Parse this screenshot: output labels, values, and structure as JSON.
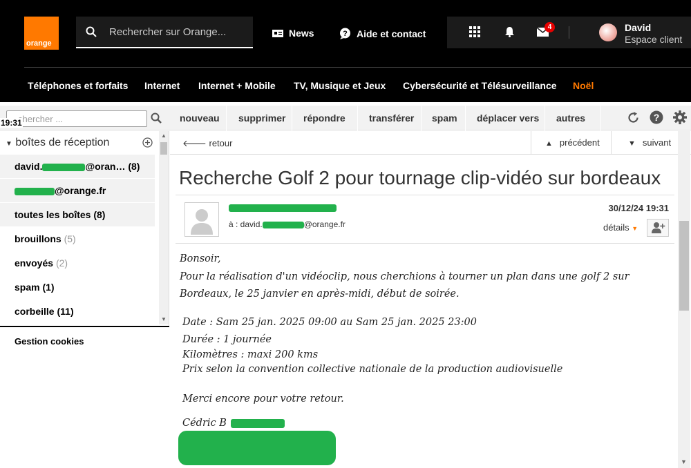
{
  "header": {
    "logo_text": "orange",
    "search_placeholder": "Rechercher sur Orange...",
    "news_label": "News",
    "help_label": "Aide et contact",
    "mail_badge": "4",
    "user_name": "David",
    "user_sub": "Espace client"
  },
  "nav": {
    "items": [
      "Téléphones et forfaits",
      "Internet",
      "Internet + Mobile",
      "TV, Musique et Jeux",
      "Cybersécurité et Télésurveillance",
      "Noël"
    ]
  },
  "toolbar": {
    "search_placeholder": "chercher ...",
    "time": "19:31",
    "buttons": [
      "nouveau",
      "supprimer",
      "répondre",
      "transférer",
      "spam",
      "déplacer vers",
      "autres"
    ]
  },
  "sidebar": {
    "title": "boîtes de réception",
    "items": [
      {
        "label": "david.",
        "label2": "@oran…",
        "count": "(8)"
      },
      {
        "label": "",
        "label2": "@orange.fr",
        "count": ""
      },
      {
        "label": "toutes les boîtes",
        "count": "(8)"
      },
      {
        "label": "brouillons",
        "count": "(5)"
      },
      {
        "label": "envoyés",
        "count": "(2)"
      },
      {
        "label": "spam",
        "count": "(1)"
      },
      {
        "label": "corbeille",
        "count": "(11)"
      }
    ],
    "cookies": "Gestion cookies"
  },
  "message": {
    "back": "retour",
    "prev": "précédent",
    "next": "suivant",
    "subject": "Recherche Golf 2 pour tournage clip-vidéo sur bordeaux",
    "to_prefix": "à : david.",
    "to_suffix": "@orange.fr",
    "date": "30/12/24 19:31",
    "details": "détails",
    "body": {
      "l1": "Bonsoir,",
      "l2": "Pour la réalisation d'un vidéoclip, nous cherchions à tourner un plan dans une golf 2 sur",
      "l3": "Bordeaux, le 25 janvier en après-midi, début de soirée.",
      "l4": "Date : Sam 25 jan. 2025 09:00  au Sam 25 jan. 2025 23:00",
      "l5": "Durée : 1 journée",
      "l6": "Kilomètres : maxi  200 kms",
      "l7": "Prix selon la convention collective nationale de la production audiovisuelle",
      "l8": "Merci encore pour votre retour.",
      "l9": "Cédric B"
    }
  },
  "colors": {
    "brand": "#ff7900",
    "redaction": "#22b14c",
    "badge": "#e70000"
  }
}
